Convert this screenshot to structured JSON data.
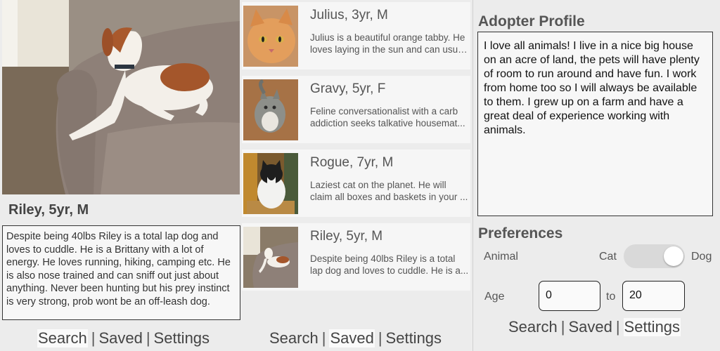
{
  "detail": {
    "name": "Riley, 5yr, M",
    "description": "Despite being 40lbs Riley is a total lap dog and loves to cuddle. He is a Brittany with a lot of energy. He loves running, hiking, camping etc. He is also nose trained and can sniff out just about anything. Never been hunting but his prey instinct is very strong, prob wont be an off-leash dog.",
    "nav": {
      "search": "Search",
      "saved": "Saved",
      "settings": "Settings",
      "sep": "|",
      "active": "search"
    }
  },
  "list": {
    "items": [
      {
        "title": "Julius, 3yr, M",
        "line1": "Julius is a beautiful orange tabby. He",
        "line2": "loves laying in the sun and can usua..."
      },
      {
        "title": "Gravy, 5yr, F",
        "line1": "Feline conversationalist with a carb",
        "line2": "addiction seeks talkative housemat..."
      },
      {
        "title": "Rogue, 7yr, M",
        "line1": "Laziest cat on the planet. He will",
        "line2": "claim all boxes and baskets in your ..."
      },
      {
        "title": "Riley, 5yr, M",
        "line1": "Despite being 40lbs Riley is a total",
        "line2": "lap dog and loves to cuddle. He is a..."
      }
    ],
    "nav": {
      "search": "Search",
      "saved": "Saved",
      "settings": "Settings",
      "sep": "|",
      "active": "saved"
    }
  },
  "settings": {
    "profile_heading": "Adopter Profile",
    "profile_text": "I love all animals! I live in a nice big house on an acre of land, the pets will have plenty of room to run around and have fun. I work from home too so I will always be available to them. I grew up on a farm and have a great deal of experience working with animals.",
    "preferences_heading": "Preferences",
    "animal_label": "Animal",
    "cat_label": "Cat",
    "dog_label": "Dog",
    "animal_selected": "Dog",
    "age_label": "Age",
    "age_min": "0",
    "age_to": "to",
    "age_max": "20",
    "nav": {
      "search": "Search",
      "saved": "Saved",
      "settings": "Settings",
      "sep": "|",
      "active": "settings"
    }
  }
}
